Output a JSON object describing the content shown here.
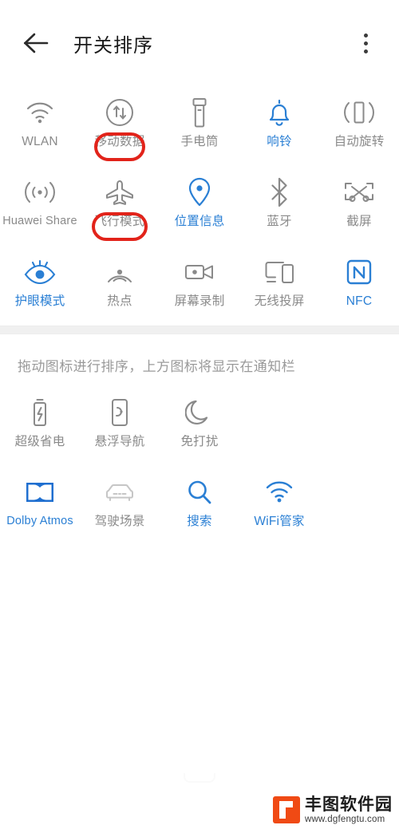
{
  "header": {
    "back_icon": "arrow-left-icon",
    "title": "开关排序",
    "overflow_icon": "more-vertical-icon"
  },
  "top_section": {
    "tiles": [
      {
        "icon": "wifi-icon",
        "label": "WLAN",
        "active": false,
        "highlighted": false
      },
      {
        "icon": "mobile-data-icon",
        "label": "移动数据",
        "active": false,
        "highlighted": true
      },
      {
        "icon": "flashlight-icon",
        "label": "手电筒",
        "active": false,
        "highlighted": false
      },
      {
        "icon": "bell-icon",
        "label": "响铃",
        "active": true,
        "highlighted": false
      },
      {
        "icon": "auto-rotate-icon",
        "label": "自动旋转",
        "active": false,
        "highlighted": false
      },
      {
        "icon": "huawei-share-icon",
        "label": "Huawei Share",
        "active": false,
        "highlighted": false
      },
      {
        "icon": "airplane-icon",
        "label": "飞行模式",
        "active": false,
        "highlighted": true
      },
      {
        "icon": "location-pin-icon",
        "label": "位置信息",
        "active": true,
        "highlighted": false
      },
      {
        "icon": "bluetooth-icon",
        "label": "蓝牙",
        "active": false,
        "highlighted": false
      },
      {
        "icon": "screenshot-icon",
        "label": "截屏",
        "active": false,
        "highlighted": false
      },
      {
        "icon": "eye-comfort-icon",
        "label": "护眼模式",
        "active": true,
        "highlighted": false
      },
      {
        "icon": "hotspot-icon",
        "label": "热点",
        "active": false,
        "highlighted": false
      },
      {
        "icon": "screen-record-icon",
        "label": "屏幕录制",
        "active": false,
        "highlighted": false
      },
      {
        "icon": "cast-screen-icon",
        "label": "无线投屏",
        "active": false,
        "highlighted": false
      },
      {
        "icon": "nfc-icon",
        "label": "NFC",
        "active": true,
        "highlighted": false
      }
    ]
  },
  "hint": "拖动图标进行排序，上方图标将显示在通知栏",
  "bottom_section": {
    "tiles": [
      {
        "icon": "battery-saver-icon",
        "label": "超级省电",
        "active": false
      },
      {
        "icon": "floating-nav-icon",
        "label": "悬浮导航",
        "active": false
      },
      {
        "icon": "do-not-disturb-icon",
        "label": "免打扰",
        "active": false
      },
      {
        "icon": "dolby-atmos-icon",
        "label": "Dolby Atmos",
        "active": true
      },
      {
        "icon": "car-icon",
        "label": "驾驶场景",
        "active": false
      },
      {
        "icon": "search-icon",
        "label": "搜索",
        "active": true
      },
      {
        "icon": "wifi-manager-icon",
        "label": "WiFi管家",
        "active": true
      }
    ]
  },
  "watermark": {
    "name": "丰图软件园",
    "url": "www.dgfengtu.com"
  },
  "colors": {
    "active": "#2a7fd4",
    "inactive": "#8a8a8a",
    "annotation": "#e2231a",
    "watermark_logo": "#f04a14"
  }
}
